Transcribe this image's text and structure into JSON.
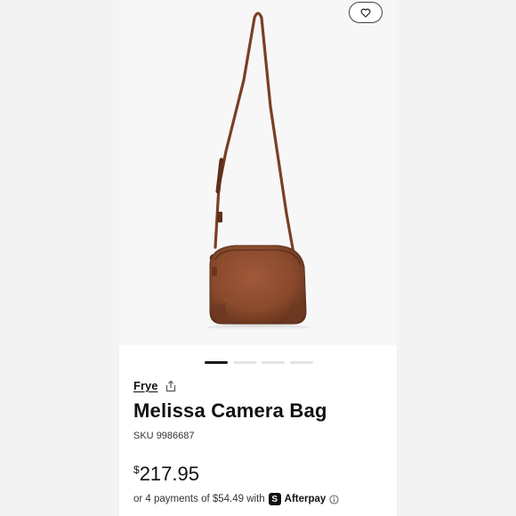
{
  "colors": {
    "leather": "#8a4a2c",
    "strap": "#7a3f24",
    "active_dot": "#1a1a1a"
  },
  "gallery": {
    "image_count": 4,
    "active_index": 0
  },
  "product": {
    "brand": "Frye",
    "title": "Melissa Camera Bag",
    "sku_label": "SKU",
    "sku": "9986687",
    "currency": "$",
    "price": "217.95",
    "installment_text": "or 4 payments of $54.49 with",
    "afterpay_badge": "S",
    "afterpay_name": "Afterpay"
  },
  "icons": {
    "favorite": "heart-icon",
    "share": "share-icon",
    "info": "info-icon",
    "afterpay": "afterpay-logo-icon"
  }
}
